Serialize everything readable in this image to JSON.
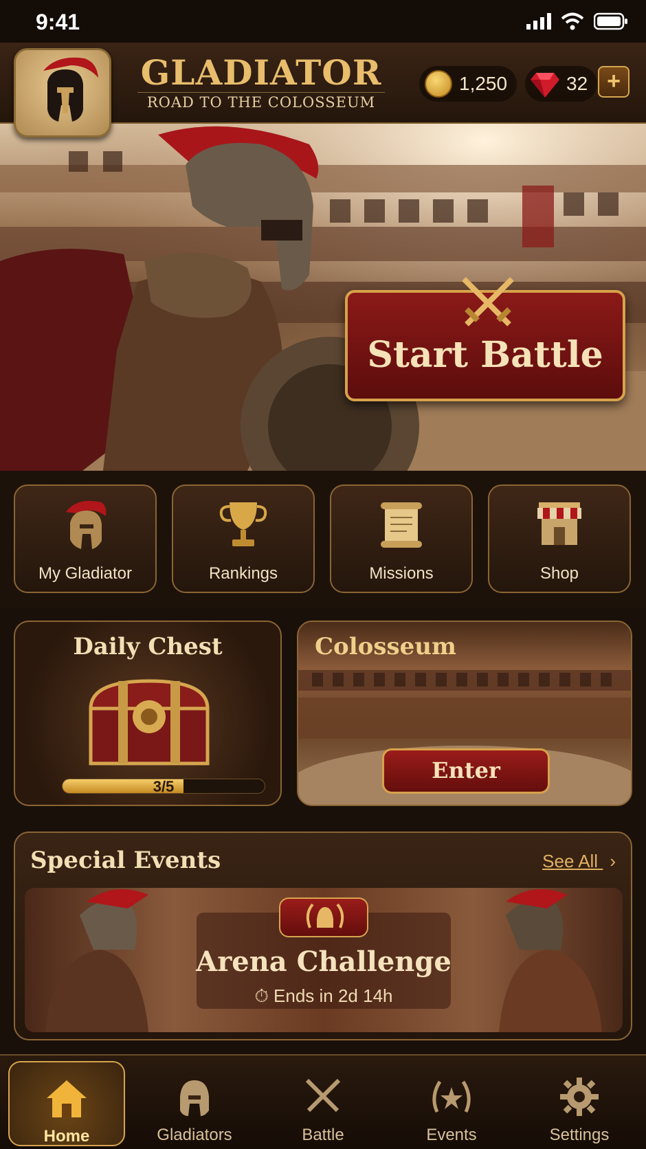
{
  "status": {
    "time": "9:41"
  },
  "header": {
    "title": "GLADIATOR",
    "subtitle": "ROAD TO THE COLOSSEUM",
    "coins": "1,250",
    "gems": "32",
    "add_label": "+"
  },
  "hero": {
    "battle_label": "Start Battle"
  },
  "quick": [
    {
      "label": "My Gladiator",
      "icon": "helmet-icon"
    },
    {
      "label": "Rankings",
      "icon": "trophy-icon"
    },
    {
      "label": "Missions",
      "icon": "scroll-icon"
    },
    {
      "label": "Shop",
      "icon": "shop-icon"
    }
  ],
  "chest": {
    "title": "Daily Chest",
    "progress_text": "3/5",
    "progress": 0.6
  },
  "colosseum": {
    "title": "Colosseum",
    "enter_label": "Enter"
  },
  "events": {
    "title": "Special Events",
    "see_all": "See All",
    "banner_title": "Arena Challenge",
    "banner_ends": "Ends in 2d 14h"
  },
  "nav": [
    {
      "label": "Home",
      "icon": "home-icon",
      "active": true
    },
    {
      "label": "Gladiators",
      "icon": "helmet-icon",
      "active": false
    },
    {
      "label": "Battle",
      "icon": "crossed-swords-icon",
      "active": false
    },
    {
      "label": "Events",
      "icon": "laurel-icon",
      "active": false
    },
    {
      "label": "Settings",
      "icon": "gear-icon",
      "active": false
    }
  ],
  "colors": {
    "gold": "#d6a64f",
    "crimson": "#8b1a18",
    "bg": "#1a100a"
  }
}
